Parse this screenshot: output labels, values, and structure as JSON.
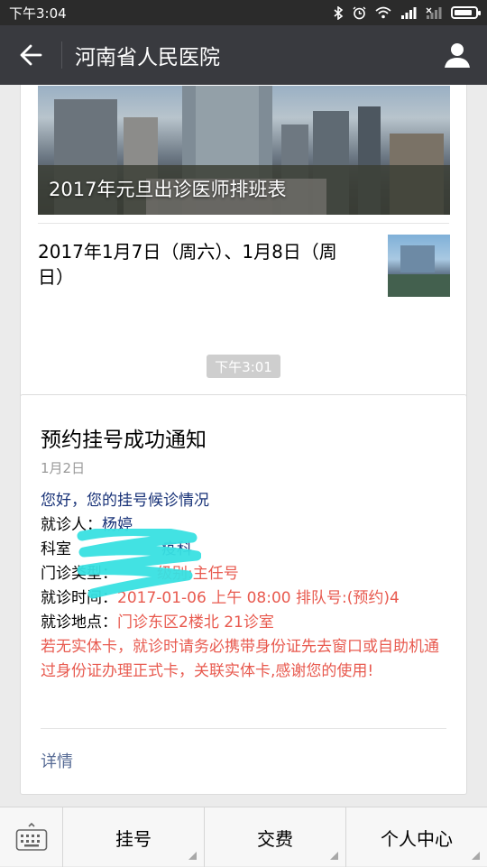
{
  "status": {
    "time": "下午3:04",
    "icons": [
      "bluetooth-icon",
      "alarm-icon",
      "wifi-icon",
      "signal-icon",
      "signal-off-icon",
      "battery-icon"
    ],
    "battery_level": 0.85
  },
  "nav": {
    "title": "河南省人民医院"
  },
  "article": {
    "banner_title": "2017年元旦出诊医师排班表",
    "sub_title": "2017年1月7日（周六）、1月8日（周日）"
  },
  "chat_time": "下午3:01",
  "notice": {
    "title": "预约挂号成功通知",
    "date": "1月2日",
    "greeting": "您好，您的挂号候诊情况",
    "patient_label": "就诊人：",
    "patient_value": "杨婷",
    "dept_label": "科室",
    "dept_value": "疫科",
    "type_label": "门诊类型：",
    "type_value": "级别:主任号",
    "time_label": "就诊时间：",
    "time_value": "2017-01-06 上午 08:00 排队号:(预约)4",
    "place_label": "就诊地点：",
    "place_value": "门诊东区2楼北 21诊室",
    "warning": "若无实体卡，就诊时请务必携带身份证先去窗口或自助机通过身份证办理正式卡，关联实体卡,感谢您的使用!",
    "detail_label": "详情"
  },
  "menu": {
    "items": [
      "挂号",
      "交费",
      "个人中心"
    ]
  },
  "colors": {
    "nav_bg": "#393a3f",
    "link_blue": "#576b95",
    "value_blue": "#173177",
    "warning_red": "#e85a4f"
  }
}
